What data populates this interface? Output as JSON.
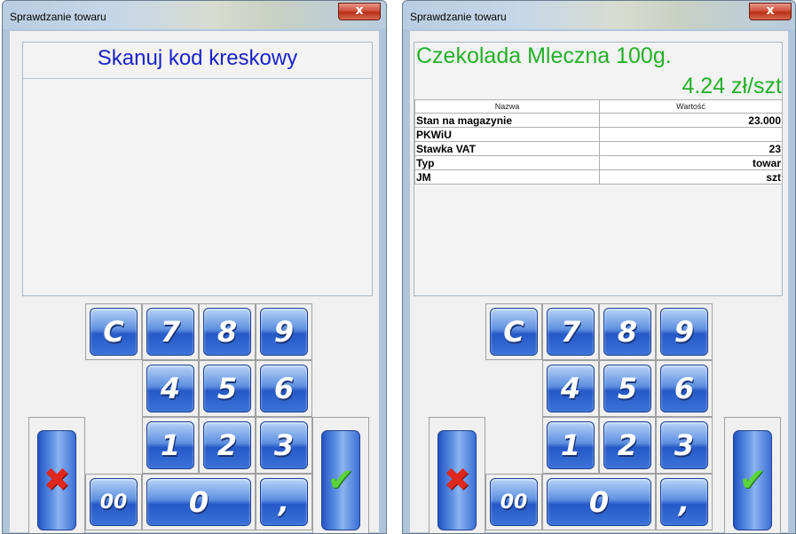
{
  "windows": [
    {
      "title": "Sprawdzanie towaru",
      "close_label": "x",
      "prompt": "Skanuj kod kreskowy"
    },
    {
      "title": "Sprawdzanie towaru",
      "close_label": "x",
      "product_name": "Czekolada Mleczna 100g.",
      "product_price": "4.24 zł/szt",
      "table": {
        "headers": [
          "Nazwa",
          "Wartość"
        ],
        "rows": [
          {
            "name": "Stan na magazynie",
            "value": "23.000"
          },
          {
            "name": "PKWiU",
            "value": ""
          },
          {
            "name": "Stawka VAT",
            "value": "23"
          },
          {
            "name": "Typ",
            "value": "towar"
          },
          {
            "name": "JM",
            "value": "szt"
          }
        ]
      }
    }
  ],
  "keypad": {
    "clear": "C",
    "k7": "7",
    "k8": "8",
    "k9": "9",
    "k4": "4",
    "k5": "5",
    "k6": "6",
    "k1": "1",
    "k2": "2",
    "k3": "3",
    "k00": "00",
    "k0": "0",
    "comma": ",",
    "cancel_icon": "x-icon",
    "ok_icon": "checkmark-icon"
  },
  "colors": {
    "prompt": "#1a22c8",
    "product": "#23b028",
    "key_blue": "#2658c7",
    "cancel": "#e0271d",
    "ok": "#5bd43a"
  }
}
